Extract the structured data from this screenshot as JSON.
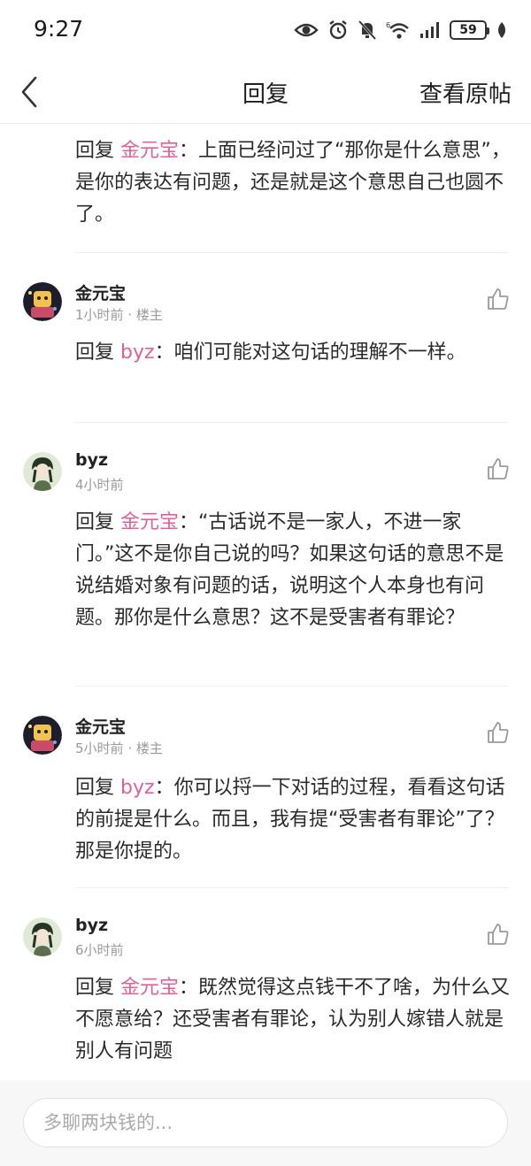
{
  "status_bar": {
    "time": "9:27",
    "battery": "59",
    "icons": [
      "eye-icon",
      "alarm-icon",
      "mute-icon",
      "wifi-icon",
      "signal-icon",
      "battery-icon",
      "leaf-icon"
    ]
  },
  "nav": {
    "back_icon": "chevron-left-icon",
    "title": "回复",
    "view_original": "查看原帖"
  },
  "reply_prefix": "回复",
  "replies": [
    {
      "mention": "金元宝",
      "text": "：上面已经问过了“那你是什么意思”，是你的表达有问题，还是就是这个意思自己也圆不了。"
    },
    {
      "username": "金元宝",
      "time": "1小时前",
      "tag": "· 楼主",
      "mention": "byz",
      "text": "：咱们可能对这句话的理解不一样。"
    },
    {
      "username": "byz",
      "time": "4小时前",
      "tag": "",
      "mention": "金元宝",
      "text": "：“古话说不是一家人，不进一家门。”这不是你自己说的吗？如果这句话的意思不是说结婚对象有问题的话，说明这个人本身也有问题。那你是什么意思？这不是受害者有罪论？"
    },
    {
      "username": "金元宝",
      "time": "5小时前",
      "tag": "· 楼主",
      "mention": "byz",
      "text": "：你可以捋一下对话的过程，看看这句话的前提是什么。而且，我有提“受害者有罪论”了？那是你提的。"
    },
    {
      "username": "byz",
      "time": "6小时前",
      "tag": "",
      "mention": "金元宝",
      "text": "：既然觉得这点钱干不了啥，为什么又不愿意给？还受害者有罪论，认为别人嫁错人就是别人有问题"
    }
  ],
  "input": {
    "placeholder": "多聊两块钱的..."
  },
  "colors": {
    "mention": "#e0619a",
    "meta": "#9a9a9a",
    "divider": "#efefef"
  }
}
